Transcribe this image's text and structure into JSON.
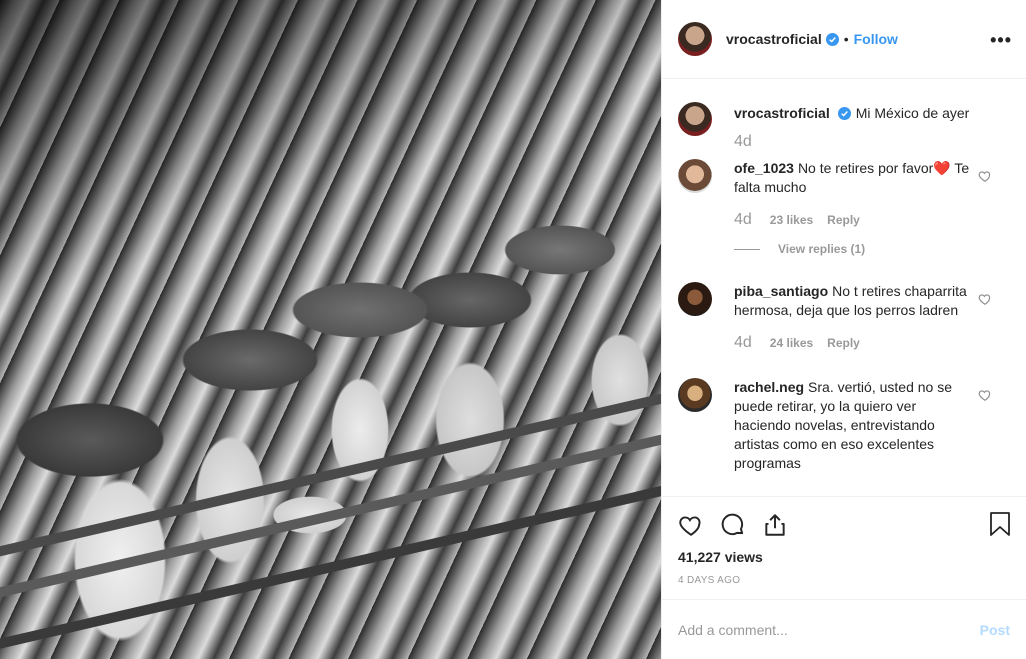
{
  "post": {
    "author": "vrocastroficial",
    "follow_label": "Follow",
    "separator": "•",
    "more_label": "•••",
    "caption": "Mi México de ayer",
    "caption_time": "4d"
  },
  "comments": [
    {
      "user": "ofe_1023",
      "text": "No te retires por favor❤️ Te falta mucho",
      "time": "4d",
      "likes": "23 likes",
      "reply": "Reply",
      "view_replies": "View replies (1)"
    },
    {
      "user": "piba_santiago",
      "text": "No t retires chaparrita hermosa, deja que los perros ladren",
      "time": "4d",
      "likes": "24 likes",
      "reply": "Reply"
    },
    {
      "user": "rachel.neg",
      "text": "Sra. vertió, usted no se puede retirar, yo la quiero ver haciendo novelas, entrevistando artistas como en eso excelentes programas"
    }
  ],
  "stats": {
    "views": "41,227 views",
    "date": "4 DAYS AGO"
  },
  "add_comment": {
    "placeholder": "Add a comment...",
    "post_label": "Post"
  },
  "colors": {
    "accent": "#3897f0",
    "post_disabled": "#b3dbff",
    "muted": "#999999",
    "text": "#262626"
  }
}
